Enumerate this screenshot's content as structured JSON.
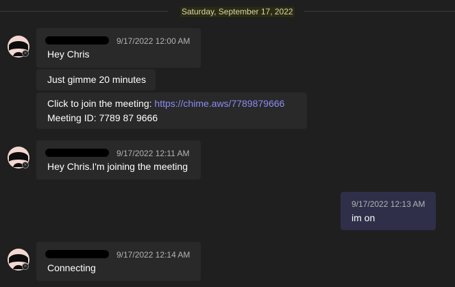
{
  "date_divider": "Saturday, September 17, 2022",
  "icons": {
    "avatar": "user-avatar-icon",
    "presence": "offline-status-icon"
  },
  "colors": {
    "background": "#1f1f1f",
    "bubble": "#292929",
    "own_bubble": "#2f2f4a",
    "link": "#8b8cf5",
    "date_highlight": "#d9d9a6"
  },
  "messages": [
    {
      "time": "9/17/2022 12:00 AM",
      "text": "Hey Chris",
      "followups": [
        {
          "text": "Just gimme 20 minutes"
        },
        {
          "text": "Click to join the meeting: ",
          "link": "https://chime.aws/7789879666",
          "line2": "Meeting ID: 7789 87 9666"
        }
      ]
    },
    {
      "time": "9/17/2022 12:11 AM",
      "text": "Hey Chris.I'm joining the meeting"
    },
    {
      "time": "9/17/2022 12:13 AM",
      "text": "im on",
      "own": true
    },
    {
      "time": "9/17/2022 12:14 AM",
      "text": "Connecting"
    }
  ]
}
